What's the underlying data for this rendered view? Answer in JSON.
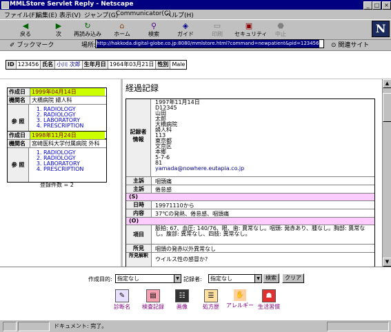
{
  "window": {
    "title": "MMLStore Servlet Reply - Netscape"
  },
  "menu": [
    "ファイル(F)",
    "編集(E)",
    "表示(V)",
    "ジャンプ(G)",
    "Communicator(C)",
    "ヘルプ(H)"
  ],
  "toolbar": {
    "back": "戻る",
    "forward": "次",
    "reload": "再読み込み",
    "home": "ホーム",
    "search": "検索",
    "guide": "ガイド",
    "print": "印刷",
    "security": "セキュリティ",
    "stop": "中止"
  },
  "location": {
    "bookmarks": "ブックマーク",
    "label": "場所:",
    "url": "http://hakkoda.digital-globe.co.jp:8080/mmlstore.html?command=newpatient&pid=123456",
    "related": "関連サイト"
  },
  "patient": {
    "id_label": "ID",
    "id": "123456",
    "name_label": "氏名",
    "name": "小川 次郎",
    "dob_label": "生年月日",
    "dob": "1964年03月21日",
    "sex_label": "性別",
    "sex": "Male"
  },
  "entries": [
    {
      "date_label": "作成日",
      "date": "1999年04月14日",
      "facility_label": "機関名",
      "facility": "大橋病院 婦人科",
      "ref_label": "参 照",
      "refs": [
        "RADIOLOGY",
        "RADIOLOGY",
        "LABORATORY",
        "PRESCRIPTION"
      ]
    },
    {
      "date_label": "作成日",
      "date": "1998年11月24日",
      "facility_label": "機関名",
      "facility": "宮崎医科大学付属病院 外科",
      "ref_label": "参 照",
      "refs": [
        "RADIOLOGY",
        "RADIOLOGY",
        "LABORATORY",
        "PRESCRIPTION"
      ]
    }
  ],
  "count_text": "登録件数 = 2",
  "record": {
    "title": "経過記録",
    "author_label": "記録者\n情報",
    "author_lines": [
      "1997年11月14日",
      "D12345",
      "山田",
      "太郎",
      "大橋病院",
      "婦人科",
      "113",
      "東京都",
      "文京区",
      "本郷",
      "5-7-6",
      "81"
    ],
    "author_email": "yamada@nowhere.eutapia.co.jp",
    "rows": [
      {
        "k": "主訴",
        "v": "咽頭痛"
      },
      {
        "k": "主訴",
        "v": "倦怠感"
      }
    ],
    "s_section": "(S)",
    "s_rows": [
      {
        "k": "日時",
        "v": "19971110から"
      },
      {
        "k": "内容",
        "v": "37℃の発熱、倦怠感、咽頭痛"
      }
    ],
    "o_section": "(O)",
    "o_rows": [
      {
        "k": "項目",
        "v": "脈拍: 67、血圧: 140/76、眼、歯: 異常なし。咽頭: 発赤あり、腫なし。胸部: 異常なし。腹部: 異常なし、四肢: 異常なし。"
      },
      {
        "k": "所見",
        "v": "咽頭の発赤以外異常なし"
      },
      {
        "k": "所見解釈",
        "v": "ウイルス性の感冒か?"
      }
    ]
  },
  "filters": {
    "purpose_label": "作成目的:",
    "purpose_value": "指定なし",
    "author_label": "記録者:",
    "author_value": "指定なし",
    "search_btn": "検索",
    "clear_btn": "クリア"
  },
  "functions": [
    {
      "label": "診断名",
      "icon": "diagnosis-icon",
      "glyph": "✎"
    },
    {
      "label": "検査記録",
      "icon": "test-record-icon",
      "glyph": "▤"
    },
    {
      "label": "画像",
      "icon": "xray-icon",
      "glyph": "☷"
    },
    {
      "label": "処方歴",
      "icon": "prescription-icon",
      "glyph": "☰"
    },
    {
      "label": "アレルギー",
      "icon": "allergy-icon",
      "glyph": "✋"
    },
    {
      "label": "生活習慣",
      "icon": "lifestyle-icon",
      "glyph": "☗"
    }
  ],
  "status": {
    "text": "ドキュメント: 完了。"
  }
}
